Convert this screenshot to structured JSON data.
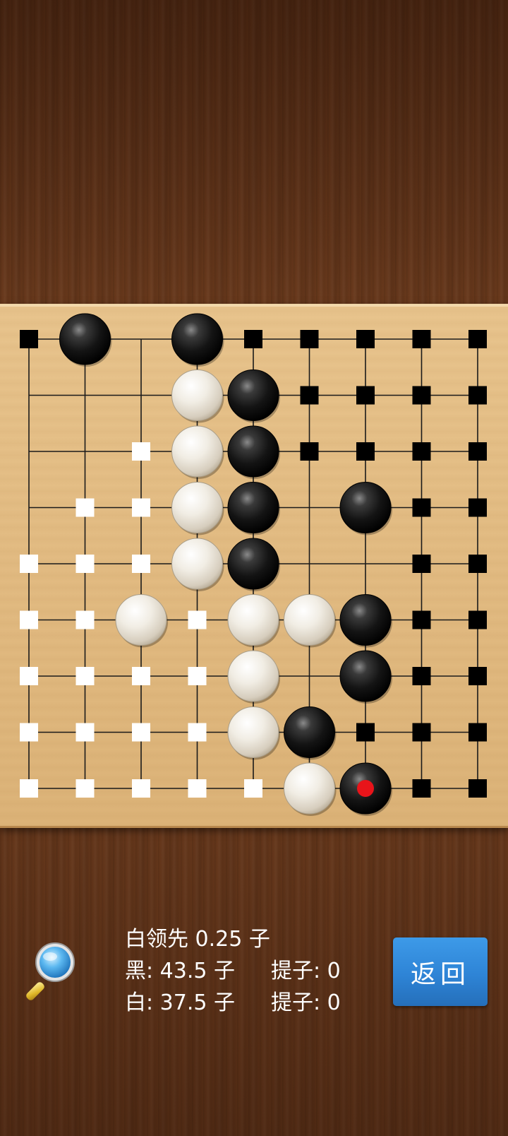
{
  "board": {
    "size": 9,
    "colors": {
      "grid_line": "#1a1a1a",
      "black_territory_marker": "#000000",
      "white_territory_marker": "#ffffff",
      "last_move_marker": "#e8141a"
    },
    "stones": [
      {
        "color": "black",
        "row": 0,
        "col": 1
      },
      {
        "color": "black",
        "row": 0,
        "col": 3
      },
      {
        "color": "white",
        "row": 1,
        "col": 3
      },
      {
        "color": "black",
        "row": 1,
        "col": 4
      },
      {
        "color": "white",
        "row": 2,
        "col": 3
      },
      {
        "color": "black",
        "row": 2,
        "col": 4
      },
      {
        "color": "white",
        "row": 3,
        "col": 3
      },
      {
        "color": "black",
        "row": 3,
        "col": 4
      },
      {
        "color": "black",
        "row": 3,
        "col": 6
      },
      {
        "color": "white",
        "row": 4,
        "col": 3
      },
      {
        "color": "black",
        "row": 4,
        "col": 4
      },
      {
        "color": "white",
        "row": 5,
        "col": 2
      },
      {
        "color": "white",
        "row": 5,
        "col": 4
      },
      {
        "color": "white",
        "row": 5,
        "col": 5
      },
      {
        "color": "black",
        "row": 5,
        "col": 6
      },
      {
        "color": "white",
        "row": 6,
        "col": 4
      },
      {
        "color": "black",
        "row": 6,
        "col": 6
      },
      {
        "color": "white",
        "row": 7,
        "col": 4
      },
      {
        "color": "black",
        "row": 7,
        "col": 5
      },
      {
        "color": "white",
        "row": 8,
        "col": 5
      },
      {
        "color": "black",
        "row": 8,
        "col": 6,
        "last_move": true
      }
    ],
    "territory": [
      {
        "owner": "black",
        "row": 0,
        "col": 0
      },
      {
        "owner": "black",
        "row": 0,
        "col": 4
      },
      {
        "owner": "black",
        "row": 0,
        "col": 5
      },
      {
        "owner": "black",
        "row": 0,
        "col": 6
      },
      {
        "owner": "black",
        "row": 0,
        "col": 7
      },
      {
        "owner": "black",
        "row": 0,
        "col": 8
      },
      {
        "owner": "black",
        "row": 1,
        "col": 5
      },
      {
        "owner": "black",
        "row": 1,
        "col": 6
      },
      {
        "owner": "black",
        "row": 1,
        "col": 7
      },
      {
        "owner": "black",
        "row": 1,
        "col": 8
      },
      {
        "owner": "white",
        "row": 2,
        "col": 2
      },
      {
        "owner": "black",
        "row": 2,
        "col": 5
      },
      {
        "owner": "black",
        "row": 2,
        "col": 6
      },
      {
        "owner": "black",
        "row": 2,
        "col": 7
      },
      {
        "owner": "black",
        "row": 2,
        "col": 8
      },
      {
        "owner": "white",
        "row": 3,
        "col": 1
      },
      {
        "owner": "white",
        "row": 3,
        "col": 2
      },
      {
        "owner": "black",
        "row": 3,
        "col": 7
      },
      {
        "owner": "black",
        "row": 3,
        "col": 8
      },
      {
        "owner": "white",
        "row": 4,
        "col": 0
      },
      {
        "owner": "white",
        "row": 4,
        "col": 1
      },
      {
        "owner": "white",
        "row": 4,
        "col": 2
      },
      {
        "owner": "black",
        "row": 4,
        "col": 7
      },
      {
        "owner": "black",
        "row": 4,
        "col": 8
      },
      {
        "owner": "white",
        "row": 5,
        "col": 0
      },
      {
        "owner": "white",
        "row": 5,
        "col": 1
      },
      {
        "owner": "white",
        "row": 5,
        "col": 3
      },
      {
        "owner": "black",
        "row": 5,
        "col": 7
      },
      {
        "owner": "black",
        "row": 5,
        "col": 8
      },
      {
        "owner": "white",
        "row": 6,
        "col": 0
      },
      {
        "owner": "white",
        "row": 6,
        "col": 1
      },
      {
        "owner": "white",
        "row": 6,
        "col": 2
      },
      {
        "owner": "white",
        "row": 6,
        "col": 3
      },
      {
        "owner": "black",
        "row": 6,
        "col": 7
      },
      {
        "owner": "black",
        "row": 6,
        "col": 8
      },
      {
        "owner": "white",
        "row": 7,
        "col": 0
      },
      {
        "owner": "white",
        "row": 7,
        "col": 1
      },
      {
        "owner": "white",
        "row": 7,
        "col": 2
      },
      {
        "owner": "white",
        "row": 7,
        "col": 3
      },
      {
        "owner": "black",
        "row": 7,
        "col": 6
      },
      {
        "owner": "black",
        "row": 7,
        "col": 7
      },
      {
        "owner": "black",
        "row": 7,
        "col": 8
      },
      {
        "owner": "white",
        "row": 8,
        "col": 0
      },
      {
        "owner": "white",
        "row": 8,
        "col": 1
      },
      {
        "owner": "white",
        "row": 8,
        "col": 2
      },
      {
        "owner": "white",
        "row": 8,
        "col": 3
      },
      {
        "owner": "white",
        "row": 8,
        "col": 4
      },
      {
        "owner": "black",
        "row": 8,
        "col": 7
      },
      {
        "owner": "black",
        "row": 8,
        "col": 8
      }
    ]
  },
  "score": {
    "lead": "白领先 0.25 子",
    "black_score": "黑: 43.5 子",
    "black_captures": "提子: 0",
    "white_score": "白: 37.5 子",
    "white_captures": "提子: 0"
  },
  "back_button": {
    "label": "返回",
    "color": "#2e84d6"
  },
  "icons": {
    "analysis": "magnifier-icon"
  }
}
